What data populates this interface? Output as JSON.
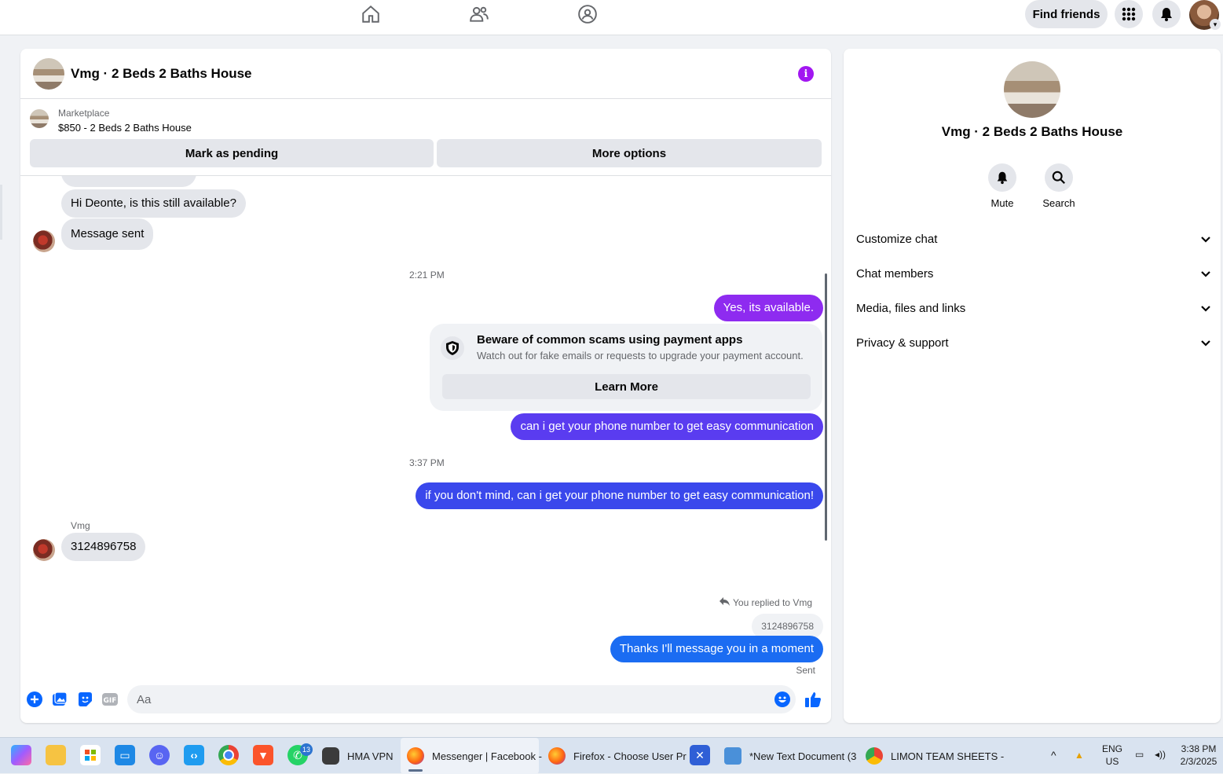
{
  "topbar": {
    "nav_icons": [
      "home-icon",
      "friends-icon",
      "groups-icon"
    ],
    "find_friends": "Find friends",
    "right_icons": [
      "menu-grid-icon",
      "notifications-icon",
      "profile-avatar"
    ]
  },
  "chat": {
    "title": "Vmg · 2 Beds 2 Baths House",
    "listing": {
      "category": "Marketplace",
      "title": "$850 - 2 Beds 2 Baths House",
      "mark_pending": "Mark as pending",
      "more_options": "More options"
    },
    "messages": {
      "in1": "Hi Deonte, is this still available?",
      "in2": "Message sent",
      "time1": "2:21 PM",
      "out1": "Yes, its available.",
      "scam_title": "Beware of common scams using payment apps",
      "scam_text": "Watch out for fake emails or requests to upgrade your payment account.",
      "learn_more": "Learn More",
      "out2": "can i get your phone number to get easy communication",
      "time2": "3:37 PM",
      "out3": "if you don't mind, can i get your phone number to get easy communication!",
      "sender": "Vmg",
      "in3": "3124896758",
      "replied_to": "You replied to Vmg",
      "quoted": "3124896758",
      "out4": "Thanks I'll message you in a moment",
      "status": "Sent"
    },
    "composer": {
      "placeholder": "Aa"
    }
  },
  "info_panel": {
    "name": "Vmg · 2 Beds 2 Baths House",
    "mute": "Mute",
    "search": "Search",
    "sections": [
      "Customize chat",
      "Chat members",
      "Media, files and links",
      "Privacy & support"
    ]
  },
  "taskbar": {
    "apps": {
      "hma": "HMA VPN",
      "messenger": "Messenger | Facebook -",
      "firefox": "Firefox - Choose User Pr",
      "notepad": "*New Text Document (3",
      "chrome": "LIMON TEAM SHEETS -"
    },
    "whatsapp_badge": "13",
    "lang": "ENG",
    "region": "US",
    "time": "3:38 PM",
    "date": "2/3/2025"
  },
  "colors": {
    "accent_purple": "#a217f1",
    "bubble_out_purple": "#8e2bf0",
    "bubble_out_indigo": "#5a3cf0",
    "bubble_out_blue": "#1b6cf2",
    "incoming": "#e4e6eb"
  }
}
